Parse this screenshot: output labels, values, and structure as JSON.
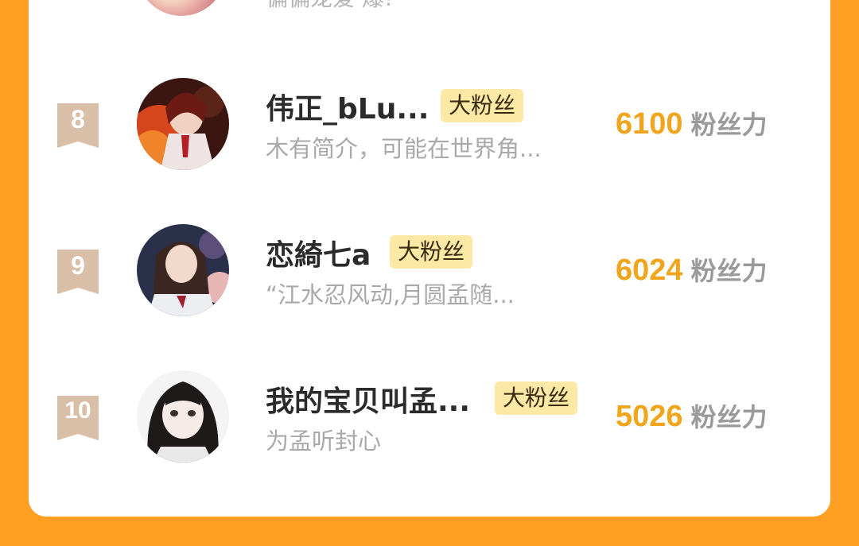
{
  "partial_row": {
    "bio": "偏偏宠爱 爆!"
  },
  "rows": [
    {
      "rank": "8",
      "name": "伟正_bLu...",
      "badge": "大粉丝",
      "bio": "木有简介，可能在世界角...",
      "power_value": "6100",
      "power_unit": "粉丝力"
    },
    {
      "rank": "9",
      "name": "恋綺七a",
      "badge": "大粉丝",
      "bio": "“江水忍风动,月圆孟随...",
      "power_value": "6024",
      "power_unit": "粉丝力"
    },
    {
      "rank": "10",
      "name": "我的宝贝叫孟...",
      "badge": "大粉丝",
      "bio": "为孟听封心",
      "power_value": "5026",
      "power_unit": "粉丝力"
    }
  ],
  "colors": {
    "accent": "#f0a51d",
    "background": "#ff9f23",
    "badge_bg": "#fde9a6",
    "rank_ribbon": "#d9bfa7"
  },
  "icons": {
    "rank": "ribbon-icon"
  }
}
